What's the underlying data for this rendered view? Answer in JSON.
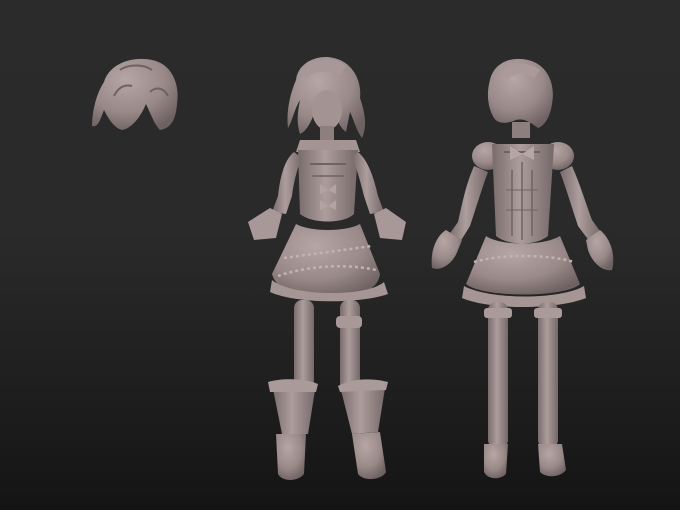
{
  "scene": {
    "description_tag": "zbrush-style-sculpt-viewport",
    "colors": {
      "background_top": "#2b2b2b",
      "background_bottom": "#141414",
      "clay": "#9c8c8c",
      "clay_light": "#b3a3a3",
      "clay_shadow": "#6f6262"
    },
    "objects": [
      {
        "name": "detached-hair-piece"
      },
      {
        "name": "figure-front-view"
      },
      {
        "name": "figure-back-view"
      }
    ]
  }
}
